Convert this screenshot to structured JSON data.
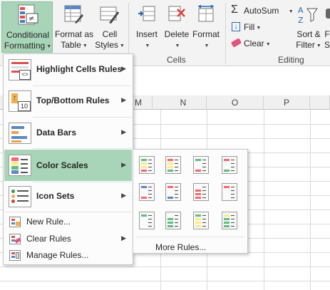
{
  "ribbon": {
    "conditional_formatting": {
      "line1": "Conditional",
      "line2": "Formatting"
    },
    "format_as_table": {
      "line1": "Format as",
      "line2": "Table"
    },
    "cell_styles": {
      "line1": "Cell",
      "line2": "Styles"
    },
    "insert": "Insert",
    "delete": "Delete",
    "format": "Format",
    "cells_group": "Cells",
    "autosum": "AutoSum",
    "fill": "Fill",
    "clear": "Clear",
    "sort_filter": {
      "line1": "Sort &",
      "line2": "Filter"
    },
    "find_partial": {
      "line1": "F",
      "line2": "S"
    },
    "editing_group": "Editing"
  },
  "sheet": {
    "columns": [
      "M",
      "N",
      "O",
      "P"
    ]
  },
  "menu": {
    "items": [
      {
        "label": "Highlight Cells Rules",
        "icon": "highlight-cells-icon"
      },
      {
        "label": "Top/Bottom Rules",
        "icon": "top-bottom-icon"
      },
      {
        "label": "Data Bars",
        "icon": "data-bars-icon"
      },
      {
        "label": "Color Scales",
        "icon": "color-scales-icon"
      },
      {
        "label": "Icon Sets",
        "icon": "icon-sets-icon"
      }
    ],
    "new_rule": "New Rule...",
    "clear_rules": "Clear Rules",
    "manage_rules": "Manage Rules..."
  },
  "submenu": {
    "more_rules": "More Rules...",
    "scales": [
      [
        "#63be7b",
        "#ffeb84",
        "#f8696b"
      ],
      [
        "#f8696b",
        "#ffeb84",
        "#63be7b"
      ],
      [
        "#63be7b",
        "#fcfcff",
        "#f8696b"
      ],
      [
        "#f8696b",
        "#fcfcff",
        "#63be7b"
      ],
      [
        "#5a8ac6",
        "#fcfcff",
        "#f8696b"
      ],
      [
        "#f8696b",
        "#fcfcff",
        "#5a8ac6"
      ],
      [
        "#fcfcff",
        "#f8696b",
        "#f8696b"
      ],
      [
        "#f8696b",
        "#fcfcff",
        "#fcfcff"
      ],
      [
        "#63be7b",
        "#fcfcff",
        "#fcfcff"
      ],
      [
        "#fcfcff",
        "#63be7b",
        "#63be7b"
      ],
      [
        "#63be7b",
        "#ffeb84",
        "#ffeb84"
      ],
      [
        "#ffeb84",
        "#63be7b",
        "#63be7b"
      ]
    ]
  },
  "colors": {
    "selected_item": "#a8d5b8",
    "ribbon_bg": "#f3f3f3"
  }
}
